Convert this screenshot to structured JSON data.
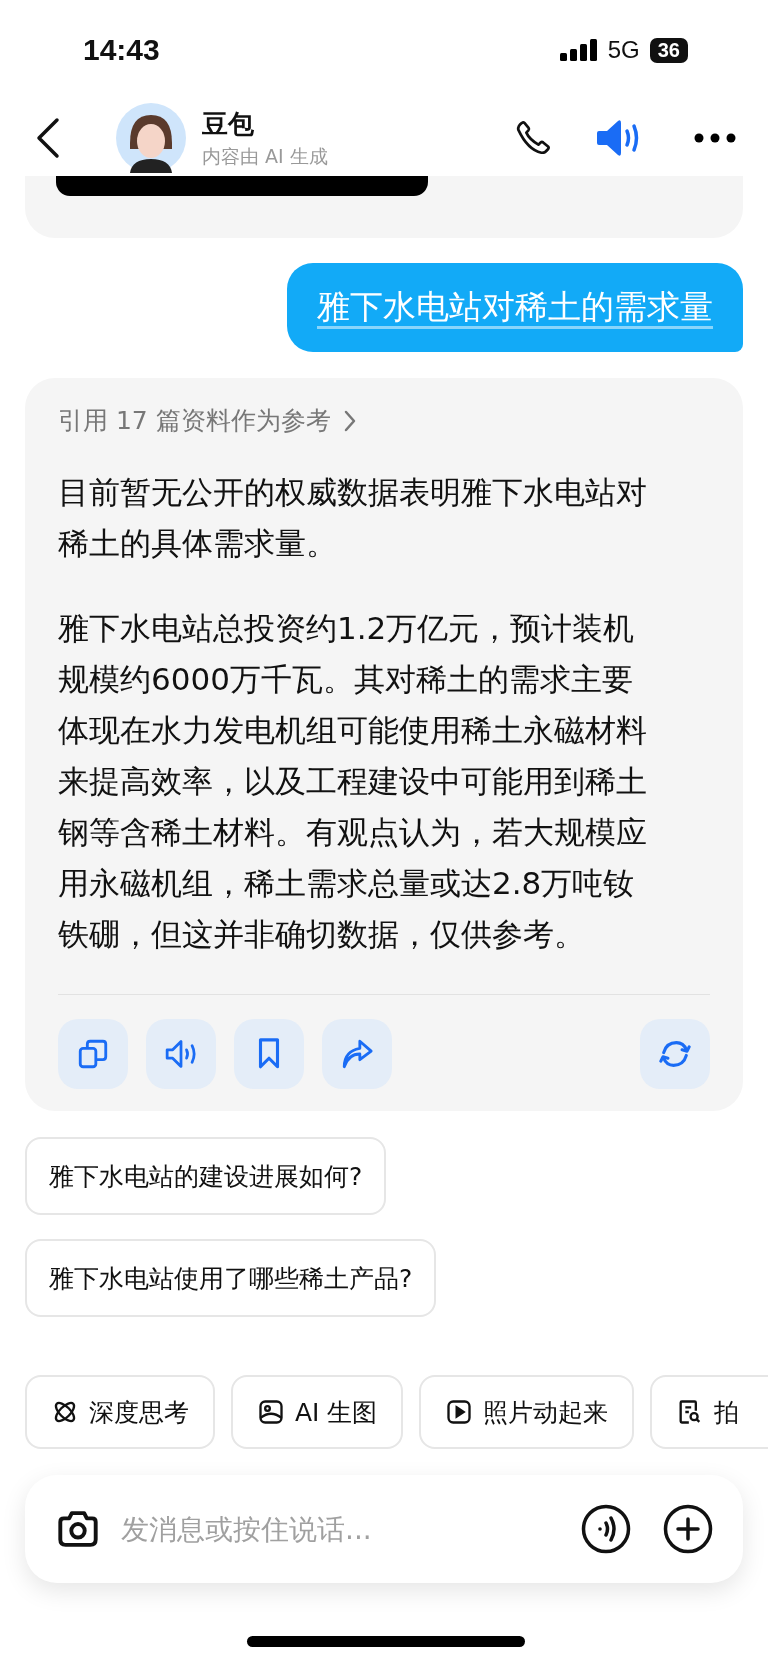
{
  "status_bar": {
    "time": "14:43",
    "network": "5G",
    "battery": "36"
  },
  "header": {
    "name": "豆包",
    "subtitle": "内容由 AI 生成"
  },
  "messages": [
    {
      "kind": "user",
      "text": "雅下水电站对稀土的需求量"
    },
    {
      "kind": "assistant",
      "reference": "引用 17 篇资料作为参考",
      "paragraphs": [
        "目前暂无公开的权威数据表明雅下水电站对稀土的具体需求量。",
        "雅下水电站总投资约1.2万亿元，预计装机规模约6000万千瓦。其对稀土的需求主要体现在水力发电机组可能使用稀土永磁材料来提高效率，以及工程建设中可能用到稀土钢等含稀土材料。有观点认为，若大规模应用永磁机组，稀土需求总量或达2.8万吨钕铁硼，但这并非确切数据，仅供参考。"
      ]
    }
  ],
  "suggestions": [
    "雅下水电站的建设进展如何?",
    "雅下水电站使用了哪些稀土产品?"
  ],
  "chips": [
    "深度思考",
    "AI 生图",
    "照片动起来",
    "拍"
  ],
  "input": {
    "placeholder": "发消息或按住说话..."
  }
}
